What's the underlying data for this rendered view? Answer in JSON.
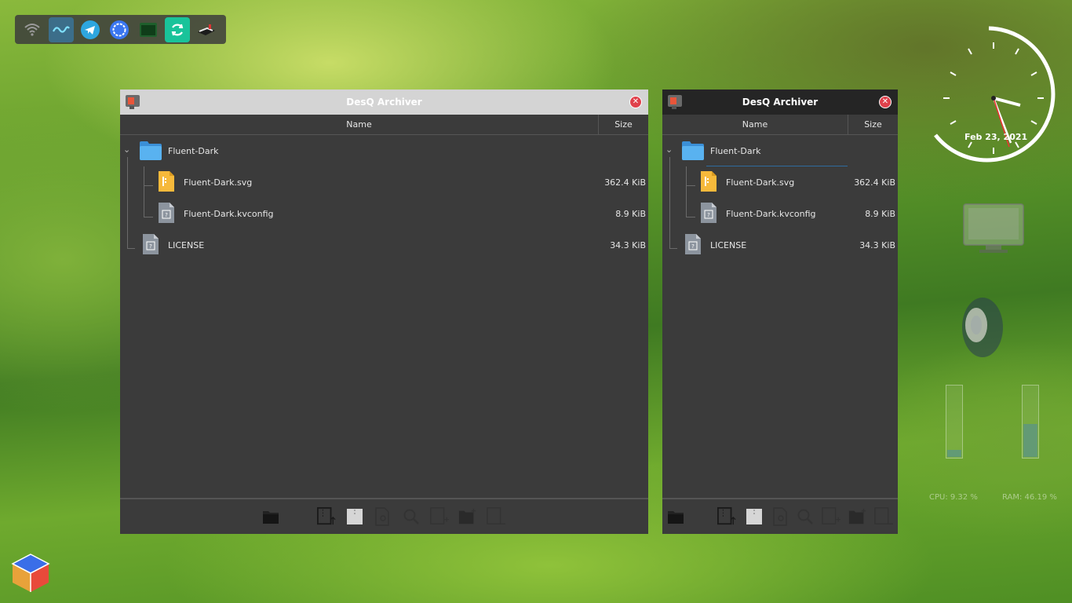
{
  "dock": {
    "items": [
      "wifi-icon",
      "kvantum-icon",
      "telegram-icon",
      "signal-icon",
      "terminal-icon",
      "sync-icon",
      "archiver-icon"
    ]
  },
  "windows": [
    {
      "title": "DesQ Archiver",
      "theme": "light-titlebar",
      "columns": {
        "name": "Name",
        "size": "Size"
      },
      "rows": [
        {
          "label": "Fluent-Dark",
          "size": "",
          "type": "folder"
        },
        {
          "label": "Fluent-Dark.svg",
          "size": "362.4 KiB",
          "type": "svg"
        },
        {
          "label": "Fluent-Dark.kvconfig",
          "size": "8.9 KiB",
          "type": "unknown"
        },
        {
          "label": "LICENSE",
          "size": "34.3 KiB",
          "type": "unknown"
        }
      ]
    },
    {
      "title": "DesQ Archiver",
      "theme": "dark-titlebar",
      "columns": {
        "name": "Name",
        "size": "Size"
      },
      "rows": [
        {
          "label": "Fluent-Dark",
          "size": "",
          "type": "folder"
        },
        {
          "label": "Fluent-Dark.svg",
          "size": "362.4 KiB",
          "type": "svg"
        },
        {
          "label": "Fluent-Dark.kvconfig",
          "size": "8.9 KiB",
          "type": "unknown"
        },
        {
          "label": "LICENSE",
          "size": "34.3 KiB",
          "type": "unknown"
        }
      ]
    }
  ],
  "toolbar_icons": [
    "open-folder-icon",
    "extract-icon",
    "archive-icon",
    "preview-icon",
    "search-icon",
    "add-file-icon",
    "add-folder-icon",
    "remove-icon"
  ],
  "widgets": {
    "clock_date": "Feb 23, 2021",
    "cpu": "CPU: 9.32 %",
    "ram": "RAM: 46.19 %",
    "cpu_level": 0.0932,
    "ram_level": 0.4619
  },
  "colors": {
    "window_bg": "#3b3b3b",
    "close_button": "#e0414b",
    "folder": "#4aa3e8",
    "svg_file": "#f6b93b"
  }
}
